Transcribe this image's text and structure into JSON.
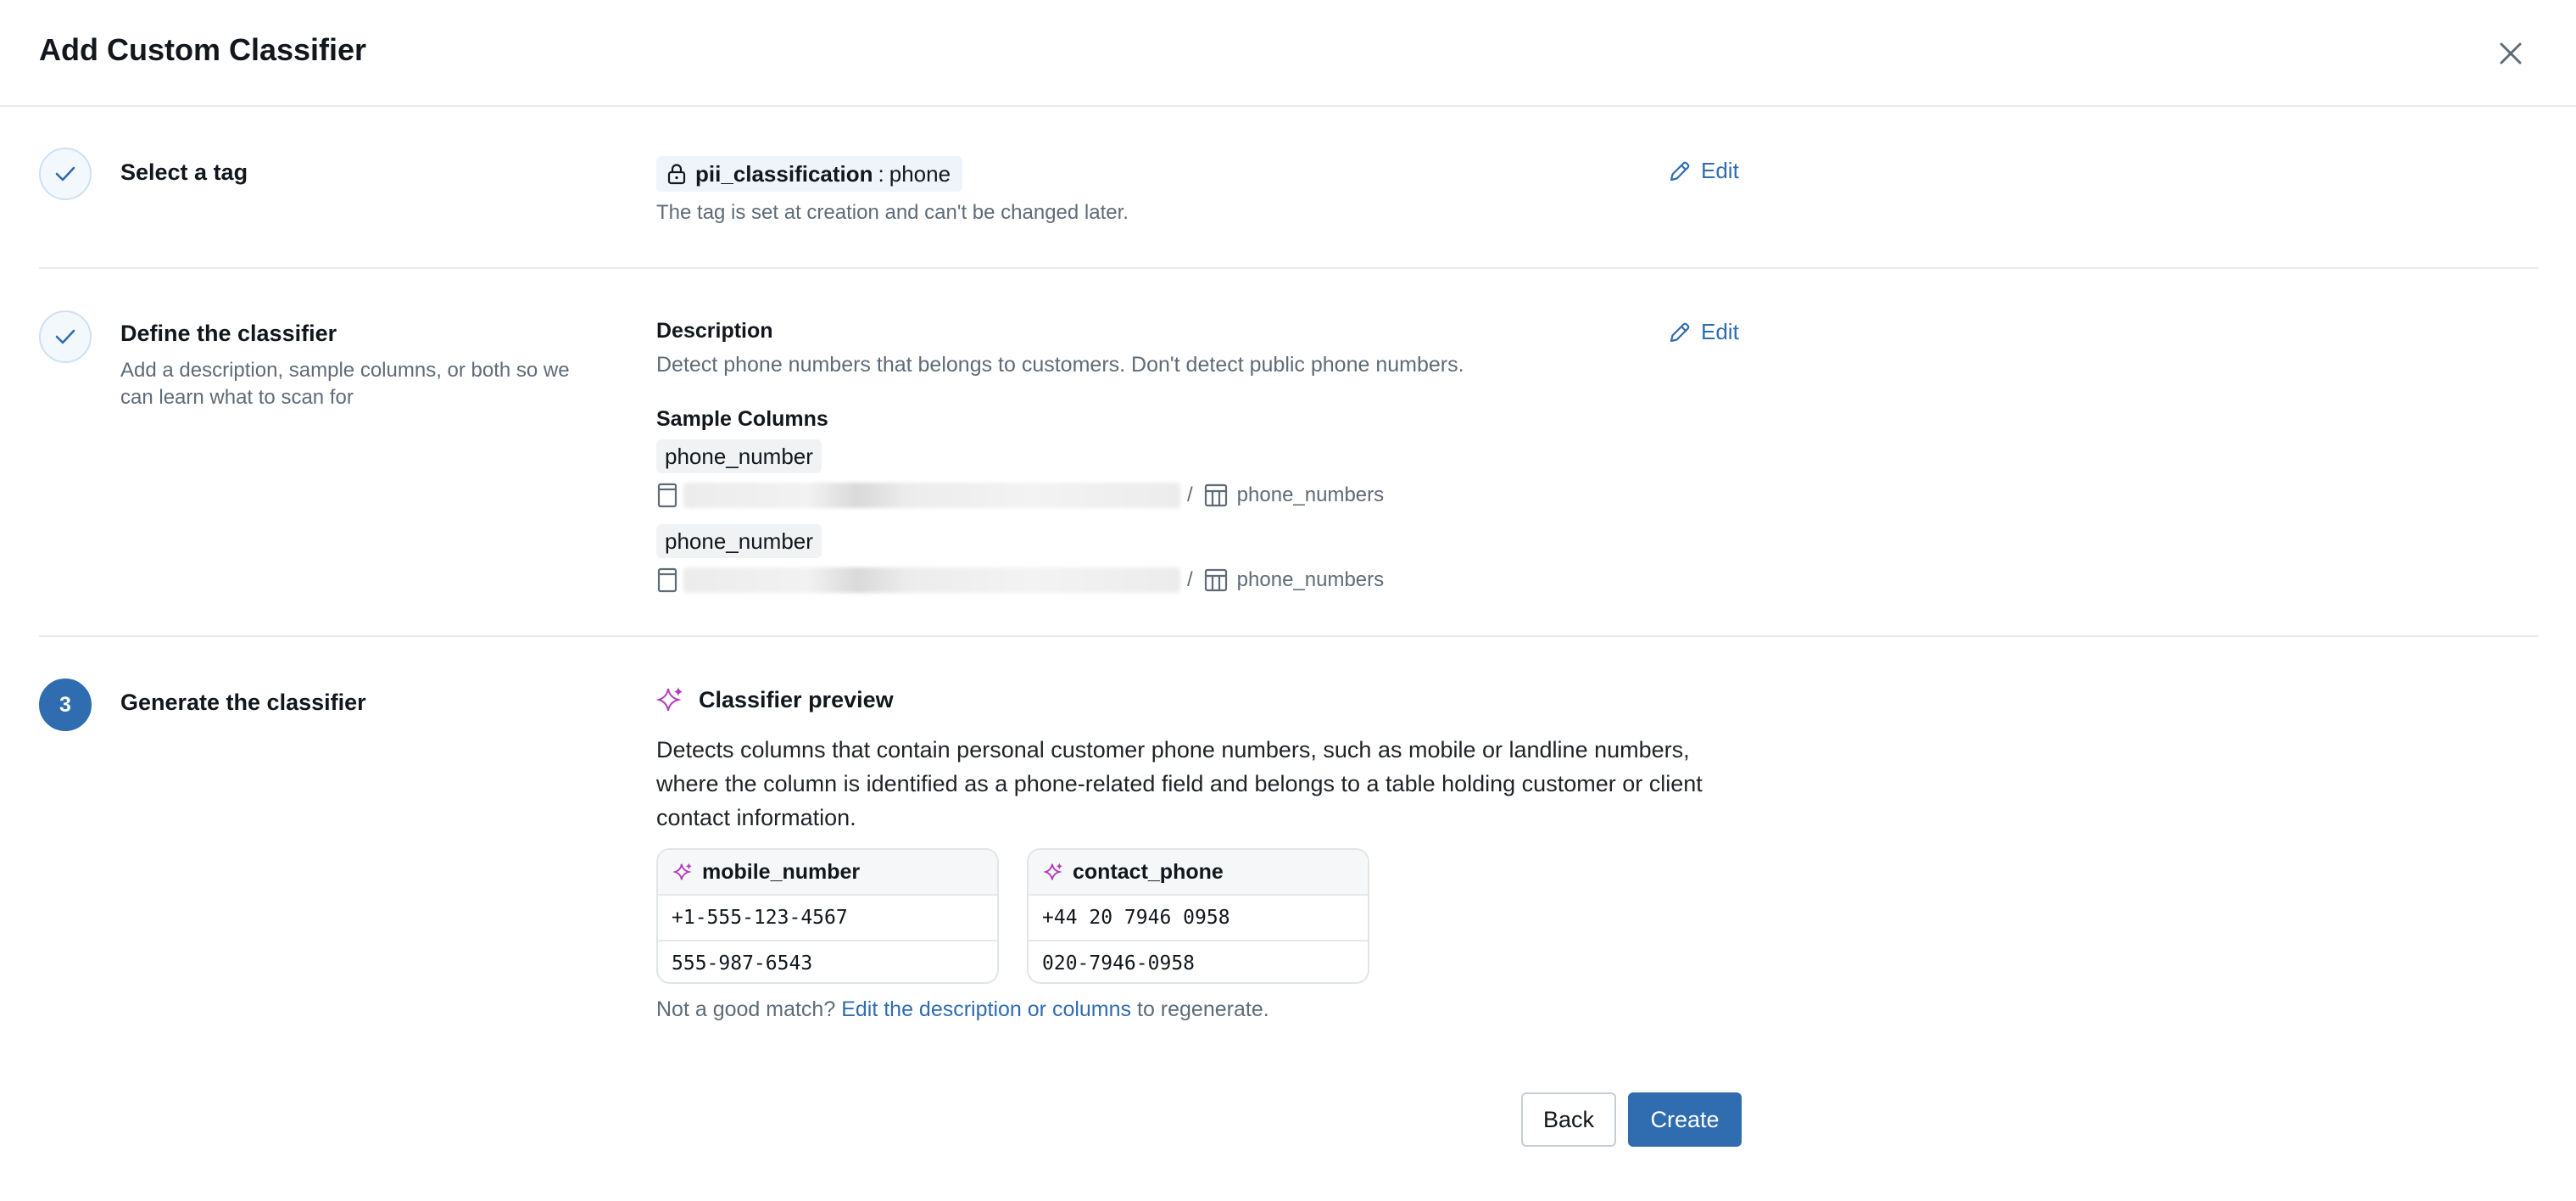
{
  "modal": {
    "title": "Add Custom Classifier"
  },
  "steps": [
    {
      "title": "Select a tag",
      "tag": {
        "key": "pii_classification",
        "separator": ":",
        "value": "phone"
      },
      "hint": "The tag is set at creation and can't be changed later.",
      "edit_label": "Edit"
    },
    {
      "title": "Define the classifier",
      "subtitle": "Add a description, sample columns, or both so we can learn what to scan for",
      "description_label": "Description",
      "description": "Detect phone numbers that belongs to customers. Don't detect public phone numbers.",
      "sample_columns_label": "Sample Columns",
      "sample_columns": [
        {
          "column": "phone_number",
          "separator": "/",
          "table": "phone_numbers"
        },
        {
          "column": "phone_number",
          "separator": "/",
          "table": "phone_numbers"
        }
      ],
      "edit_label": "Edit"
    },
    {
      "number": "3",
      "title": "Generate the classifier",
      "preview_title": "Classifier preview",
      "preview_text": "Detects columns that contain personal customer phone numbers, such as mobile or landline numbers, where the column is identified as a phone-related field and belongs to a table holding customer or client contact information.",
      "samples": [
        {
          "name": "mobile_number",
          "values": [
            "+1-555-123-4567",
            "555-987-6543"
          ]
        },
        {
          "name": "contact_phone",
          "values": [
            "+44 20 7946 0958",
            "020-7946-0958"
          ]
        }
      ],
      "regen_prefix": "Not a good match?",
      "regen_link": "Edit the description or columns",
      "regen_suffix": "to regenerate."
    }
  ],
  "footer": {
    "back_label": "Back",
    "create_label": "Create"
  },
  "colors": {
    "accent": "#2f6cb0",
    "sparkle": "#b23fb8",
    "muted_text": "#5f6b76"
  }
}
